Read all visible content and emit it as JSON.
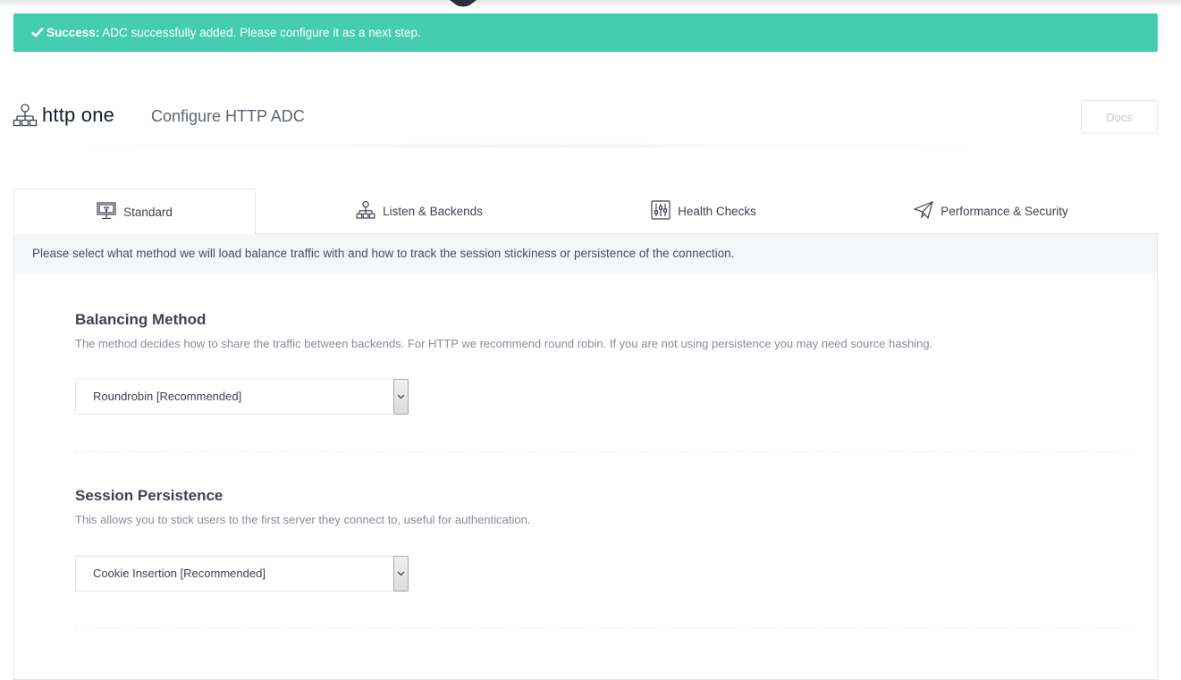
{
  "alert": {
    "strong": "Success:",
    "message": "ADC successfully added. Please configure it as a next step.",
    "icon": "check-icon",
    "color": "#46cdb0"
  },
  "header": {
    "icon": "sitemap-icon",
    "title": "http one",
    "subtitle": "Configure HTTP ADC",
    "docs_label": "Docs"
  },
  "tabs": [
    {
      "label": "Standard",
      "icon": "monitor-icon",
      "active": true
    },
    {
      "label": "Listen & Backends",
      "icon": "sitemap-icon",
      "active": false
    },
    {
      "label": "Health Checks",
      "icon": "sliders-icon",
      "active": false
    },
    {
      "label": "Performance & Security",
      "icon": "paper-plane-icon",
      "active": false
    }
  ],
  "panel": {
    "intro": "Please select what method we will load balance traffic with and how to track the session stickiness or persistence of the connection.",
    "sections": [
      {
        "title": "Balancing Method",
        "description": "The method decides how to share the traffic between backends. For HTTP we recommend round robin. If you are not using persistence you may need source hashing.",
        "selected": "Roundrobin [Recommended]"
      },
      {
        "title": "Session Persistence",
        "description": "This allows you to stick users to the first server they connect to, useful for authentication.",
        "selected": "Cookie Insertion [Recommended]"
      }
    ]
  }
}
